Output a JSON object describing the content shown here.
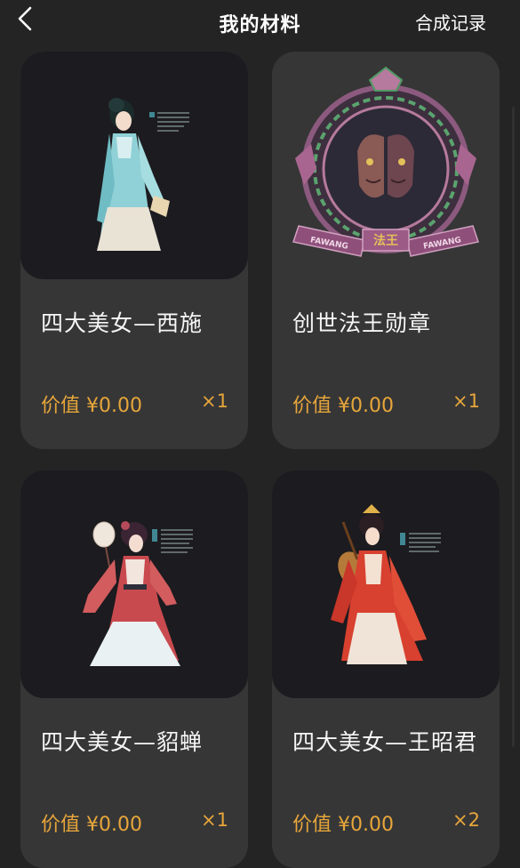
{
  "header": {
    "back_icon": "chevron-left-icon",
    "title": "我的材料",
    "records_label": "合成记录"
  },
  "items": [
    {
      "name": "四大美女—西施",
      "price_label": "价值",
      "currency": "¥",
      "price": "0.00",
      "qty": "×1"
    },
    {
      "name": "创世法王勋章",
      "price_label": "价值",
      "currency": "¥",
      "price": "0.00",
      "qty": "×1"
    },
    {
      "name": "四大美女—貂蝉",
      "price_label": "价值",
      "currency": "¥",
      "price": "0.00",
      "qty": "×1"
    },
    {
      "name": "四大美女—王昭君",
      "price_label": "价值",
      "currency": "¥",
      "price": "0.00",
      "qty": "×2"
    }
  ],
  "badge": {
    "banner_left": "FAWANG",
    "banner_right": "FAWANG",
    "center_text": "法王"
  },
  "colors": {
    "background": "#242425",
    "card": "#363637",
    "thumb": "#1c1b1f",
    "accent": "#e7a63a"
  }
}
